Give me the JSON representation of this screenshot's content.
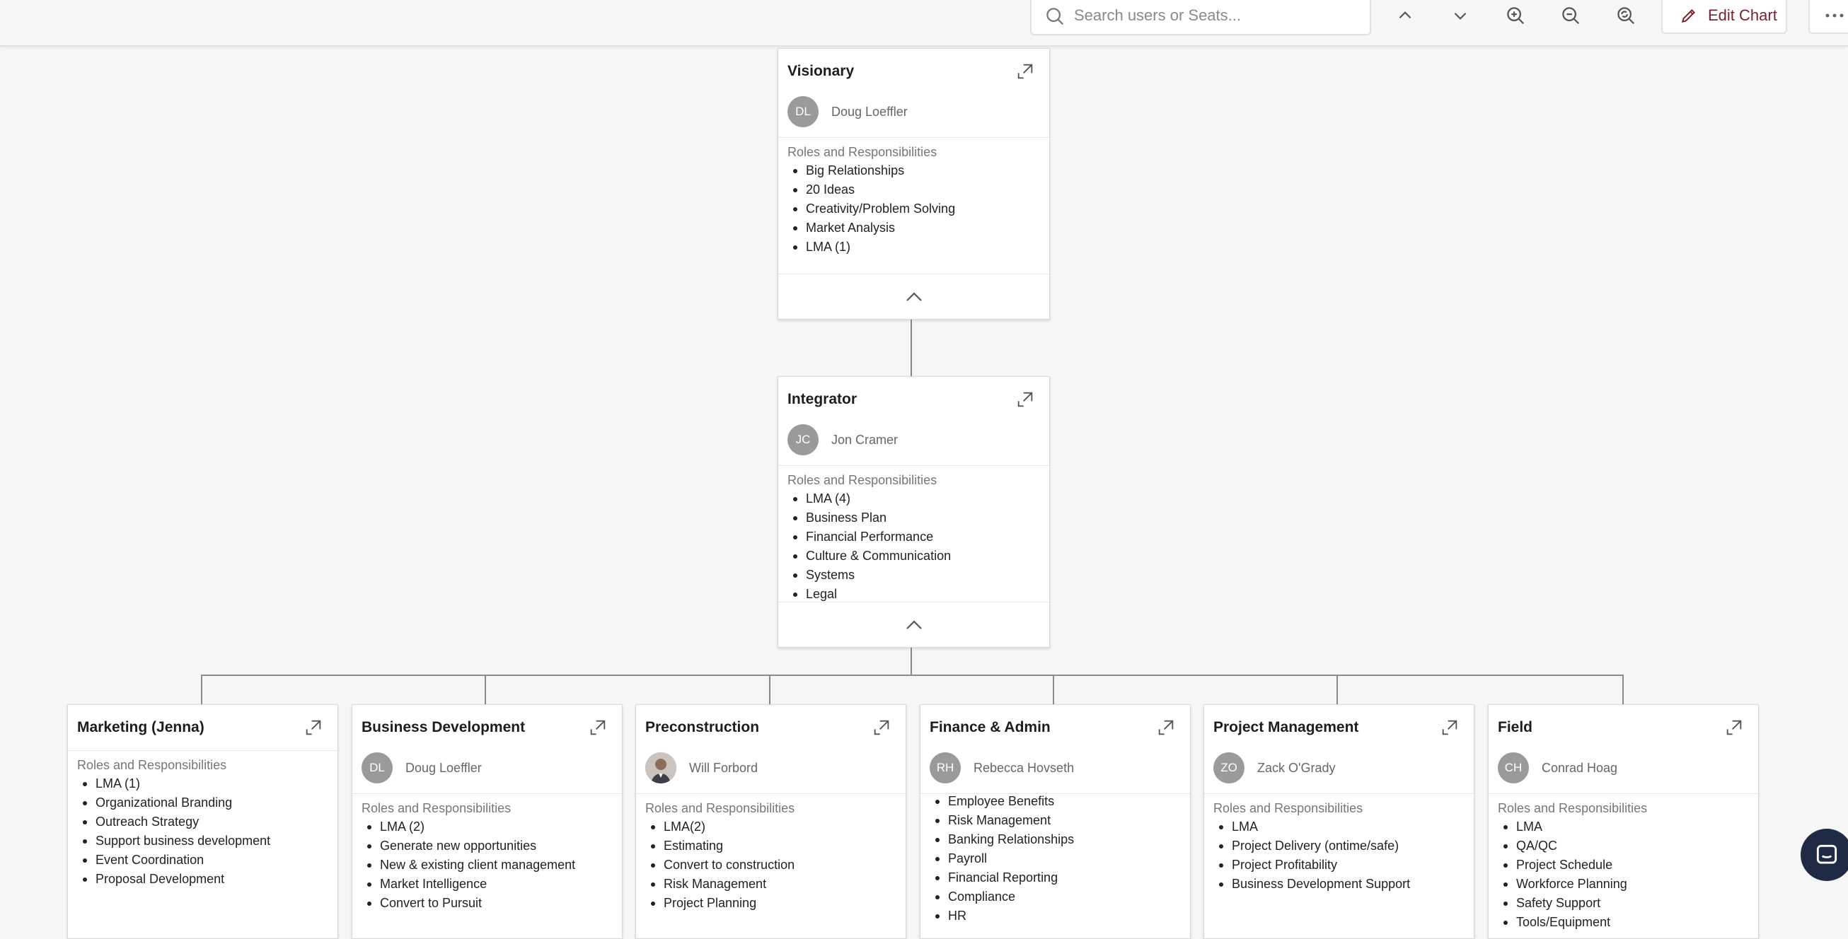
{
  "toolbar": {
    "search_placeholder": "Search users or Seats...",
    "edit_label": "Edit Chart",
    "accent_color": "#7a1f2b"
  },
  "visionary": {
    "title": "Visionary",
    "initials": "DL",
    "name": "Doug Loeffler",
    "roles_label": "Roles and Responsibilities",
    "roles": [
      "Big Relationships",
      "20 Ideas",
      "Creativity/Problem Solving",
      "Market Analysis",
      "LMA (1)"
    ]
  },
  "integrator": {
    "title": "Integrator",
    "initials": "JC",
    "name": "Jon Cramer",
    "roles_label": "Roles and Responsibilities",
    "roles": [
      "LMA (4)",
      "Business Plan",
      "Financial Performance",
      "Culture & Communication",
      "Systems",
      "Legal"
    ]
  },
  "departments": [
    {
      "title": "Marketing (Jenna)",
      "roles_label": "Roles and Responsibilities",
      "roles": [
        "LMA (1)",
        "Organizational Branding",
        "Outreach Strategy",
        "Support business development",
        "Event Coordination",
        "Proposal Development"
      ]
    },
    {
      "title": "Business Development",
      "initials": "DL",
      "name": "Doug Loeffler",
      "roles_label": "Roles and Responsibilities",
      "roles": [
        "LMA (2)",
        "Generate new opportunities",
        "New & existing client management",
        "Market Intelligence",
        "Convert to Pursuit"
      ]
    },
    {
      "title": "Preconstruction",
      "name": "Will Forbord",
      "roles_label": "Roles and Responsibilities",
      "roles": [
        "LMA(2)",
        "Estimating",
        "Convert to construction",
        "Risk Management",
        "Project Planning"
      ]
    },
    {
      "title": "Finance & Admin",
      "initials": "RH",
      "name": "Rebecca Hovseth",
      "roles": [
        "Employee Benefits",
        "Risk Management",
        "Banking Relationships",
        "Payroll",
        "Financial Reporting",
        "Compliance",
        "HR"
      ]
    },
    {
      "title": "Project Management",
      "initials": "ZO",
      "name": "Zack O'Grady",
      "roles_label": "Roles and Responsibilities",
      "roles": [
        "LMA",
        "Project Delivery (ontime/safe)",
        "Project Profitability",
        "Business Development Support"
      ]
    },
    {
      "title": "Field",
      "initials": "CH",
      "name": "Conrad Hoag",
      "roles_label": "Roles and Responsibilities",
      "roles": [
        "LMA",
        "QA/QC",
        "Project Schedule",
        "Workforce Planning",
        "Safety Support",
        "Tools/Equipment"
      ]
    }
  ]
}
